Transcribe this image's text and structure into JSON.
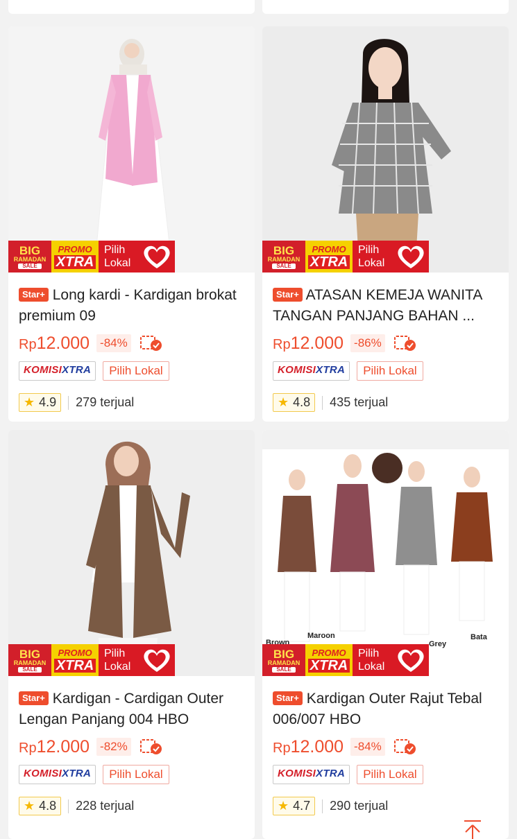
{
  "promo": {
    "big": "BIG",
    "ramadan": "RAMADAN",
    "sale": "SALE",
    "promo": "PROMO",
    "xtra": "XTRA",
    "pilih": "Pilih",
    "lokal": "Lokal"
  },
  "labels": {
    "star_badge": "Star+",
    "komisi_a": "KOMISI",
    "komisi_b": "XTRA",
    "pilih_lokal": "Pilih Lokal",
    "rp": "Rp"
  },
  "products": [
    {
      "title": "Long kardi - Kardigan brokat premium 09",
      "price": "12.000",
      "discount": "-84%",
      "rating": "4.9",
      "sold": "279 terjual"
    },
    {
      "title": "ATASAN KEMEJA WANITA TANGAN PANJANG BAHAN ...",
      "price": "12.000",
      "discount": "-86%",
      "rating": "4.8",
      "sold": "435 terjual"
    },
    {
      "title": "Kardigan - Cardigan Outer Lengan Panjang 004 HBO",
      "price": "12.000",
      "discount": "-82%",
      "rating": "4.8",
      "sold": "228 terjual"
    },
    {
      "title": "Kardigan Outer Rajut Tebal 006/007 HBO",
      "price": "12.000",
      "discount": "-84%",
      "rating": "4.7",
      "sold": "290 terjual"
    }
  ],
  "image_labels": {
    "brown": "Brown",
    "maroon": "Maroon",
    "grey": "Grey",
    "bata": "Bata"
  },
  "colors": {
    "accent": "#ee4d2d",
    "promo_red": "#d21f2a",
    "promo_yellow": "#f5d100"
  }
}
